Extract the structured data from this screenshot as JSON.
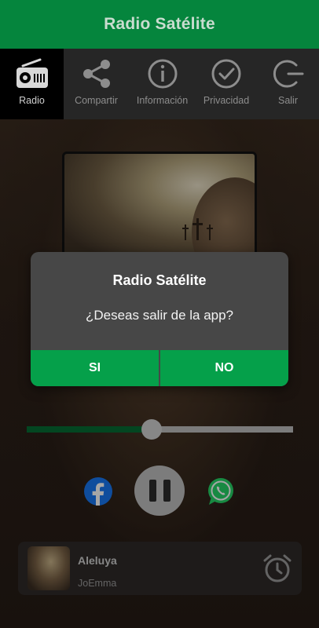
{
  "header": {
    "title": "Radio Satélite"
  },
  "nav": {
    "items": [
      {
        "label": "Radio",
        "icon": "radio-icon"
      },
      {
        "label": "Compartir",
        "icon": "share-icon"
      },
      {
        "label": "Información",
        "icon": "info-icon"
      },
      {
        "label": "Privacidad",
        "icon": "check-circle-icon"
      },
      {
        "label": "Salir",
        "icon": "exit-icon"
      }
    ]
  },
  "dialog": {
    "title": "Radio Satélite",
    "message": "¿Deseas salir de la app?",
    "yes_label": "SI",
    "no_label": "NO"
  },
  "player": {
    "volume": 0.47,
    "now_playing": {
      "title": "Aleluya",
      "artist": "JoEmma"
    }
  },
  "colors": {
    "brand_green": "#05853d",
    "button_green": "#05a04a",
    "facebook_blue": "#1877f2",
    "whatsapp_green": "#25d366"
  }
}
